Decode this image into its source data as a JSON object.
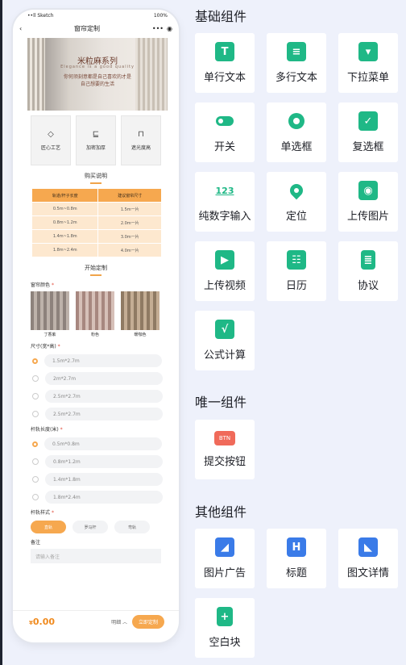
{
  "phone": {
    "status": {
      "carrier": "••ll Sketch",
      "battery": "100%"
    },
    "nav": {
      "title": "窗帘定制",
      "menu": "•••",
      "target": "◉"
    },
    "banner": {
      "title": "米粒麻系列",
      "subtitle": "Elegance is a good quality",
      "line1": "你何须刻意都是自己喜欢的才是",
      "line2": "自己想要的生活"
    },
    "features": [
      {
        "icon": "diamond-icon",
        "glyph": "◇",
        "label": "匠心工艺"
      },
      {
        "icon": "box-icon",
        "glyph": "⊑",
        "label": "加密加厚"
      },
      {
        "icon": "curtain-icon",
        "glyph": "⊓",
        "label": "遮光度高"
      }
    ],
    "buy_title": "购买说明",
    "table": {
      "headers": [
        "轨道/杆子长度",
        "建议窗帘尺寸"
      ],
      "rows": [
        [
          "0.5m~0.8m",
          "1.5m一片"
        ],
        [
          "0.8m~1.2m",
          "2.0m一片"
        ],
        [
          "1.4m~1.8m",
          "3.0m一片"
        ],
        [
          "1.8m~2.4m",
          "4.0m一片"
        ]
      ]
    },
    "custom_title": "开始定制",
    "color_label": "窗帘颜色",
    "req": "*",
    "colors": [
      {
        "name": "丁香紫",
        "hex": "#9b8f8a"
      },
      {
        "name": "粉色",
        "hex": "#b89a92"
      },
      {
        "name": "暖咖色",
        "hex": "#a58c72"
      }
    ],
    "size_label": "尺寸(宽*高)",
    "sizes": [
      "1.5m*2.7m",
      "2m*2.7m",
      "2.5m*2.7m",
      "2.5m*2.7m"
    ],
    "rail_label": "杆轨长度(米)",
    "rails": [
      "0.5m*0.8m",
      "0.8m*1.2m",
      "1.4m*1.8m",
      "1.8m*2.4m"
    ],
    "style_label": "杆轨样式",
    "styles": [
      "直轨",
      "罗马杆",
      "弯轨"
    ],
    "note_label": "备注",
    "note_placeholder": "请输入备注",
    "price": "0.00",
    "currency": "¥",
    "detail": "明细 ︿",
    "submit": "立即定制"
  },
  "sections": {
    "basic": "基础组件",
    "unique": "唯一组件",
    "other": "其他组件"
  },
  "cards": {
    "single_text": "单行文本",
    "multi_text": "多行文本",
    "dropdown": "下拉菜单",
    "switch": "开关",
    "radio": "单选框",
    "checkbox": "复选框",
    "number": "纯数字输入",
    "location": "定位",
    "upload_image": "上传图片",
    "upload_video": "上传视频",
    "calendar": "日历",
    "agreement": "协议",
    "formula": "公式计算",
    "submit_button": "提交按钮",
    "btn_badge": "BTN",
    "image_ad": "图片广告",
    "heading": "标题",
    "rich_detail": "图文详情",
    "blank": "空白块",
    "number_badge": "123"
  },
  "colors": {
    "accent": "#1fb886",
    "orange": "#f6a84f",
    "blue": "#3a7be8"
  }
}
